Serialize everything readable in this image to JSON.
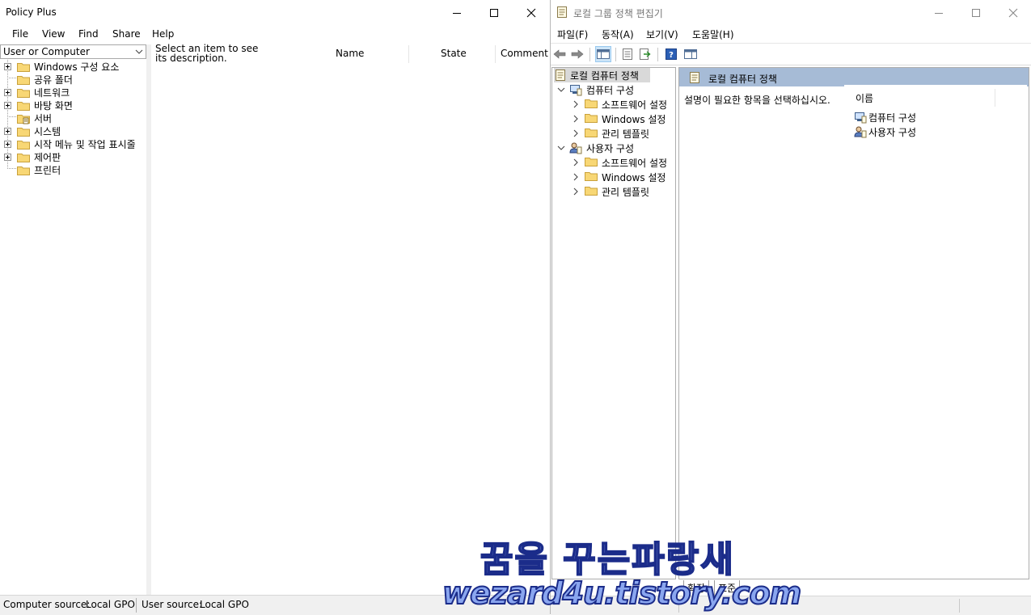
{
  "policy_plus": {
    "title": "Policy Plus",
    "menu": [
      "File",
      "View",
      "Find",
      "Share",
      "Help"
    ],
    "scope_combo": "User or Computer",
    "tree": [
      {
        "label": "Windows 구성 요소",
        "expandable": true
      },
      {
        "label": "공유 폴더",
        "expandable": false
      },
      {
        "label": "네트워크",
        "expandable": true
      },
      {
        "label": "바탕 화면",
        "expandable": true
      },
      {
        "label": "서버",
        "expandable": false
      },
      {
        "label": "시스템",
        "expandable": true
      },
      {
        "label": "시작 메뉴 및 작업 표시줄",
        "expandable": true
      },
      {
        "label": "제어판",
        "expandable": true
      },
      {
        "label": "프린터",
        "expandable": false
      }
    ],
    "description": "Select an item to see its description.",
    "columns": [
      "Name",
      "State",
      "Comment"
    ],
    "status": {
      "computer_source_label": "Computer source:",
      "computer_source_value": "Local GPO",
      "user_source_label": "User source:",
      "user_source_value": "Local GPO"
    }
  },
  "gpedit": {
    "title": "로컬 그룹 정책 편집기",
    "menu": [
      "파일(F)",
      "동작(A)",
      "보기(V)",
      "도움말(H)"
    ],
    "tree": {
      "root": "로컬 컴퓨터 정책",
      "computer": {
        "label": "컴퓨터 구성",
        "children": [
          "소프트웨어 설정",
          "Windows 설정",
          "관리 템플릿"
        ]
      },
      "user": {
        "label": "사용자 구성",
        "children": [
          "소프트웨어 설정",
          "Windows 설정",
          "관리 템플릿"
        ]
      }
    },
    "details": {
      "header": "로컬 컴퓨터 정책",
      "description": "설명이 필요한 항목을 선택하십시오.",
      "column": "이름",
      "items": [
        "컴퓨터 구성",
        "사용자 구성"
      ]
    },
    "tabs": [
      "확장",
      "표준"
    ]
  },
  "watermark": {
    "line1": "꿈을 꾸는파랑새",
    "line2": "wezard4u.tistory.com"
  }
}
